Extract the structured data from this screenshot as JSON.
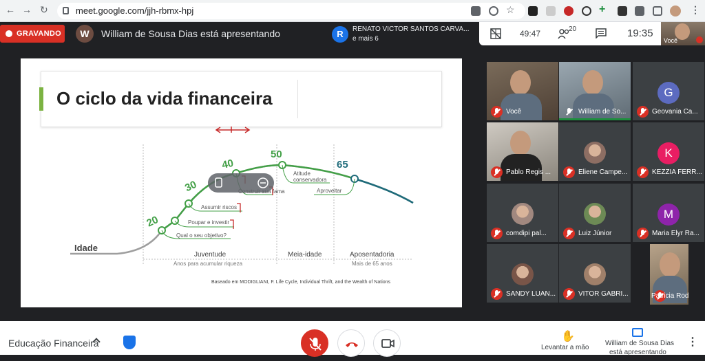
{
  "browser": {
    "url": "meet.google.com/jjh-rbmx-hpj",
    "back_icon": "back-arrow-icon",
    "forward_icon": "forward-arrow-icon",
    "reload_icon": "reload-icon"
  },
  "topbar": {
    "recording_label": "GRAVANDO",
    "presenter_initial": "W",
    "presenter_text": "William de Sousa Dias está apresentando",
    "notification": {
      "initial": "R",
      "name": "RENATO VICTOR SANTOS CARVA...",
      "more": "e mais 6"
    },
    "elapsed": "49:47",
    "participants_count": "20",
    "clock": "19:35",
    "self_label": "Você"
  },
  "slide": {
    "title": "O ciclo da vida financeira",
    "axis_label": "Idade",
    "ages": [
      "20",
      "30",
      "40",
      "50",
      "65"
    ],
    "steps": [
      "Qual o seu objetivo?",
      "Poupar e investir",
      "Assumir riscos",
      "Construir sua fama",
      "Atitude",
      "conservadora",
      "Aproveitar"
    ],
    "phases": [
      "Juventude",
      "Meia-idade",
      "Aposentadoria"
    ],
    "phase_notes": [
      "Anos para acumular riqueza",
      "Mais de 65 anos"
    ],
    "credit": "Baseado em MODIGLIANI, F. Life Cycle, Individual Thrift, and the Wealth of Nations"
  },
  "participants": [
    {
      "name": "Você",
      "type": "video"
    },
    {
      "name": "William de So...",
      "type": "video"
    },
    {
      "name": "Geovania Ca...",
      "type": "letter",
      "initial": "G",
      "color": "#5c6bc0"
    },
    {
      "name": "Pablo Regis ...",
      "type": "video"
    },
    {
      "name": "Eliene Campe...",
      "type": "photo"
    },
    {
      "name": "KEZZIA FERR...",
      "type": "letter",
      "initial": "K",
      "color": "#e91e63"
    },
    {
      "name": "comdipi pal...",
      "type": "photo"
    },
    {
      "name": "Luiz Júnior",
      "type": "photo"
    },
    {
      "name": "Maria Elyr Ra...",
      "type": "letter",
      "initial": "M",
      "color": "#8e24aa"
    },
    {
      "name": "SANDY LUAN...",
      "type": "photo"
    },
    {
      "name": "VITOR GABRI...",
      "type": "photo"
    },
    {
      "name": "Patricia Rodri...",
      "type": "video"
    }
  ],
  "bottombar": {
    "meeting_name": "Educação Financeira",
    "raise_hand": "Levantar a mão",
    "presenting_line1": "William de Sousa Dias",
    "presenting_line2": "está apresentando"
  }
}
